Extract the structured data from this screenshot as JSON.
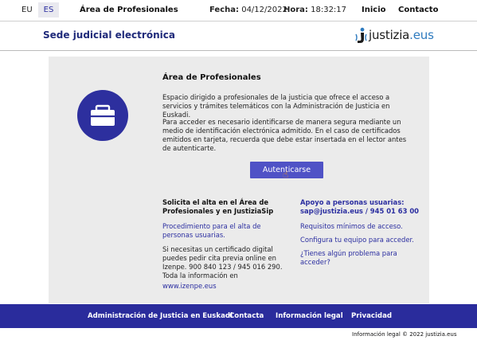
{
  "topbar": {
    "lang_eu": "EU",
    "lang_es": "ES",
    "area": "Área de Profesionales",
    "fecha_label": "Fecha:",
    "fecha_value": "04/12/2022",
    "hora_label": "Hora:",
    "hora_value": "18:32:17",
    "inicio": "Inicio",
    "contacto": "Contacto"
  },
  "header": {
    "sede": "Sede judicial electrónica",
    "logo_word": "justizia",
    "logo_suffix": ".eus"
  },
  "main": {
    "title": "Área de Profesionales",
    "paragraph1": "Espacio dirigido a profesionales de la justicia que ofrece el acceso a servicios y trámites telemáticos con la Administración de Justicia en Euskadi.",
    "paragraph2": "Para acceder es necesario identificarse de manera segura mediante un medio de identificación electrónica admitido. En el caso de certificados emitidos en tarjeta, recuerda que debe estar insertada en el lector antes de autenticarte.",
    "auth_button": "Autenticarse",
    "left_title": "Solicita el alta en el Área de Profesionales y en JustiziaSip",
    "procedure_link": "Procedimiento para el alta de personas usuarias.",
    "cert_text": "Si necesitas un certificado digital puedes pedir cita previa online en Izenpe. 900 840 123 / 945 016 290. Toda la información en",
    "izenpe_link": "www.izenpe.eus",
    "right_title": "Apoyo a personas usuarias:",
    "right_contact": "sap@justizia.eus / 945 01 63 00",
    "req_link": "Requisitos mínimos de acceso.",
    "conf_link": "Configura tu equipo para acceder.",
    "problem_link": "¿Tienes algún problema para acceder?"
  },
  "footer": {
    "items": [
      "Administración de Justicia en Euskadi",
      "Contacta",
      "Información legal",
      "Privacidad"
    ],
    "bottom_line": "Información legal © 2022 justizia.eus"
  },
  "colors": {
    "brand_blue": "#2a2c9c",
    "button_blue": "#4f52c6",
    "link_blue": "#2b2ea0",
    "panel_gray": "#ebebeb"
  },
  "icons": {
    "badge": "briefcase-icon",
    "logo": "justizia-logo-mark",
    "cursor": "hand-pointer-icon"
  }
}
